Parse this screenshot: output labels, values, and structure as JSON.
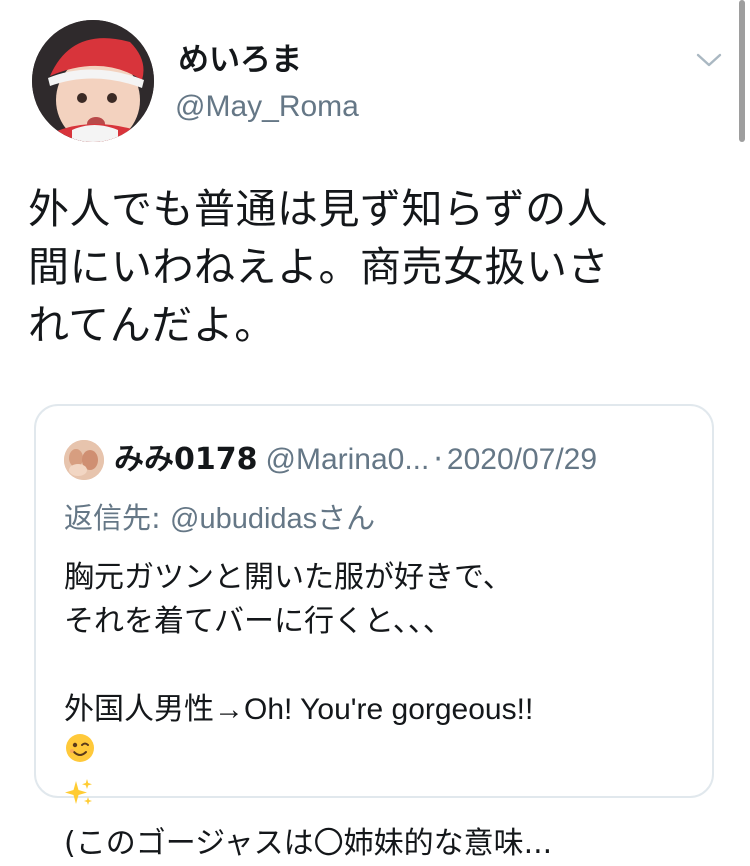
{
  "tweet": {
    "author_name": "めいろま",
    "author_handle": "@May_Roma",
    "text_lines": [
      "外人でも普通は見ず知らずの人",
      "間にいわねえよ。商売女扱いさ",
      "れてんだよ。"
    ],
    "menu_icon": "chevron-down-icon"
  },
  "quoted": {
    "name": "みみ0178",
    "handle": "@Marina0...",
    "separator": "·",
    "date": "2020/07/29",
    "reply_to_label": "返信先: ",
    "reply_to_handle": "@ubudidas",
    "reply_to_suffix": "さん",
    "lines": [
      "胸元ガツンと開いた服が好きで、",
      "それを着てバーに行くと、、、",
      "",
      "外国人男性→Oh! You're gorgeous!!",
      "(このゴージャスは〇姉妹的な意味..."
    ],
    "emoji_wink": "winking-face-emoji",
    "emoji_sparkles": "sparkles-emoji"
  },
  "colors": {
    "text": "#14171a",
    "secondary": "#657786",
    "border": "#e1e8ed"
  }
}
